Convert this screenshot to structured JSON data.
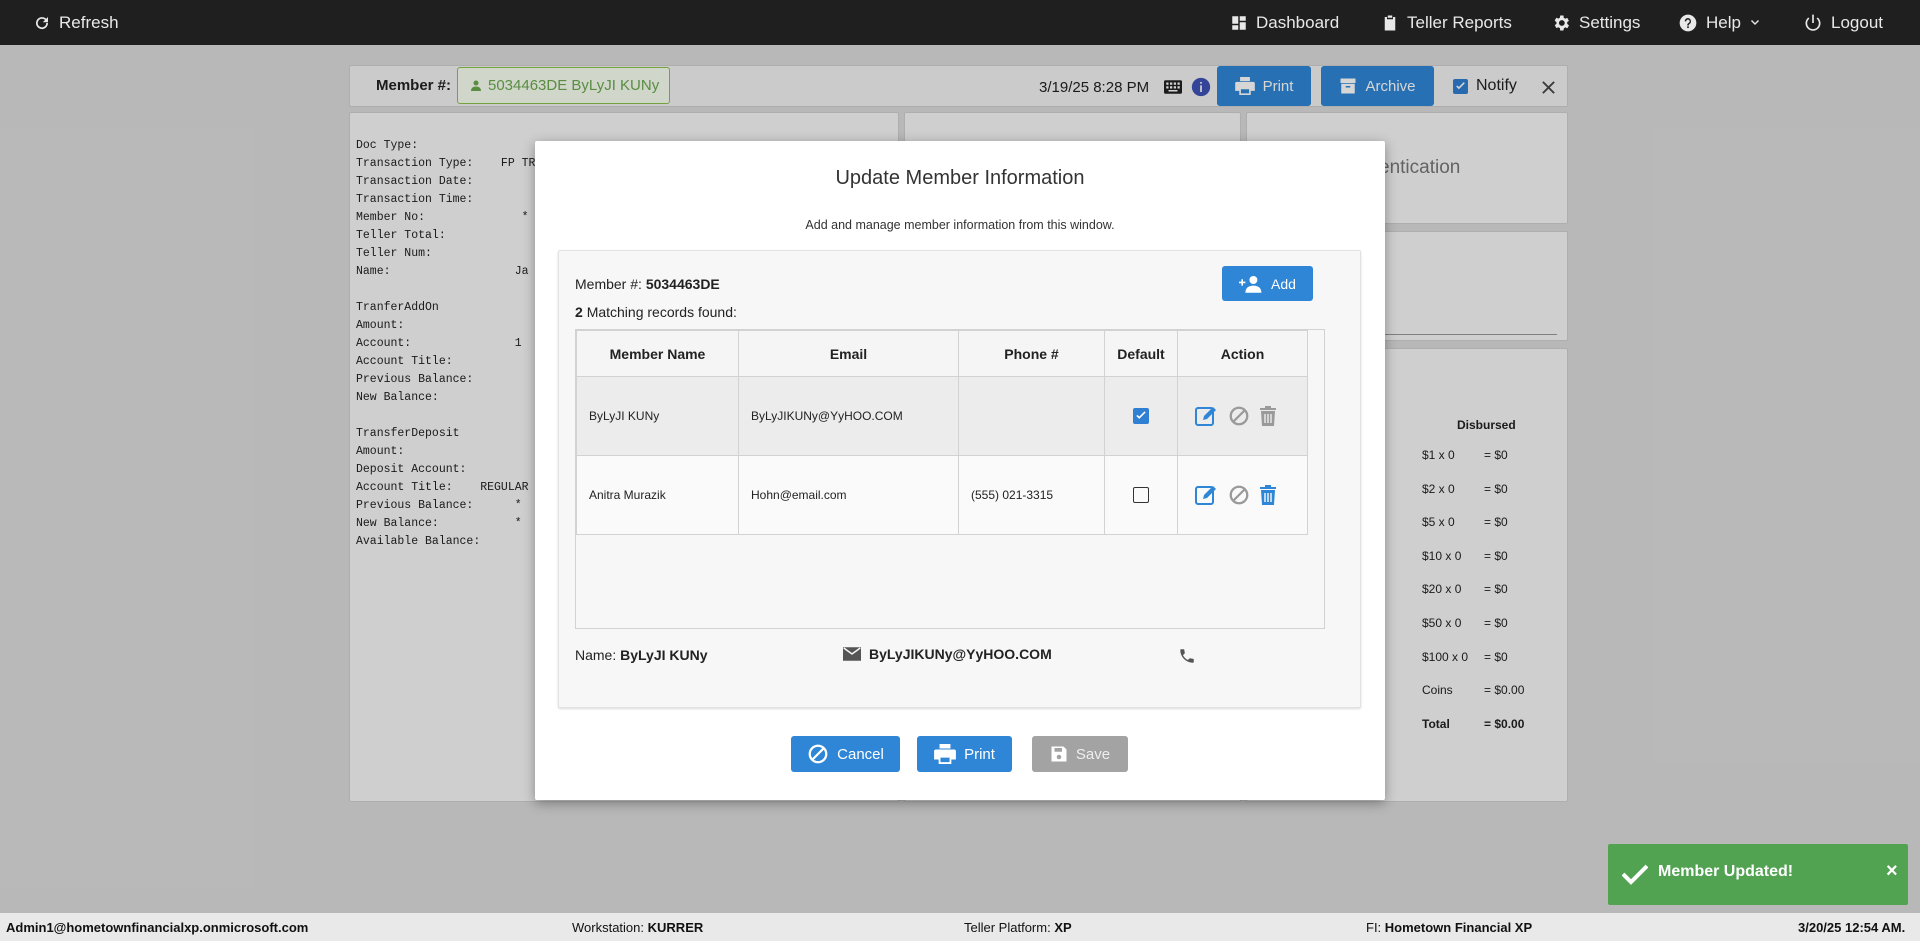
{
  "topbar": {
    "refresh": "Refresh",
    "dashboard": "Dashboard",
    "teller_reports": "Teller Reports",
    "settings": "Settings",
    "help": "Help",
    "logout": "Logout"
  },
  "header": {
    "member_label": "Member #:",
    "member_value": "5034463DE ByLyJI KUNy",
    "datetime": "3/19/25 8:28 PM",
    "print": "Print",
    "archive": "Archive",
    "notify": "Notify"
  },
  "receipt": {
    "lines": "Doc Type:\nTransaction Type:    FP TRA\nTransaction Date:\nTransaction Time:\nMember No:              *\nTeller Total:\nTeller Num:\nName:                  Ja\n\nTranferAddOn\nAmount:\nAccount:               1\nAccount Title:\nPrevious Balance:\nNew Balance:\n\nTransferDeposit\nAmount:\nDeposit Account:\nAccount Title:    REGULAR\nPrevious Balance:      *\nNew Balance:           *\nAvailable Balance:"
  },
  "right_panel": {
    "auth_title": "entication",
    "disbursed_header": "Disbursed",
    "rows": [
      {
        "label": "$1 x 0",
        "value": "= $0"
      },
      {
        "label": "$2 x 0",
        "value": "= $0"
      },
      {
        "label": "$5 x 0",
        "value": "= $0"
      },
      {
        "label": "$10 x 0",
        "value": "= $0"
      },
      {
        "label": "$20 x 0",
        "value": "= $0"
      },
      {
        "label": "$50 x 0",
        "value": "= $0"
      },
      {
        "label": "$100 x 0",
        "value": "= $0"
      },
      {
        "label": "Coins",
        "value": "= $0.00"
      },
      {
        "label": "Total",
        "value": "= $0.00"
      }
    ]
  },
  "modal": {
    "title": "Update Member Information",
    "subtitle": "Add and manage member information from this window.",
    "member_label": "Member #:",
    "member_value": "5034463DE",
    "add": "Add",
    "match_count": "2",
    "match_text": "Matching records found:",
    "columns": [
      "Member Name",
      "Email",
      "Phone #",
      "Default",
      "Action"
    ],
    "rows": [
      {
        "name": "ByLyJI KUNy",
        "email": "ByLyJIKUNy@YyHOO.COM",
        "phone": "",
        "default": true
      },
      {
        "name": "Anitra Murazik",
        "email": "Hohn@email.com",
        "phone": "(555) 021-3315",
        "default": false
      }
    ],
    "name_label": "Name:",
    "name_value": "ByLyJI KUNy",
    "email_value": "ByLyJIKUNy@YyHOO.COM",
    "cancel": "Cancel",
    "print": "Print",
    "save": "Save"
  },
  "toast": {
    "message": "Member Updated!",
    "close": "×"
  },
  "status": {
    "user": "Admin1@hometownfinancialxp.onmicrosoft.com",
    "workstation_label": "Workstation:",
    "workstation": "KURRER",
    "platform_label": "Teller Platform:",
    "platform": "XP",
    "fi_label": "FI:",
    "fi": "Hometown Financial XP",
    "datetime": "3/20/25 12:54 AM."
  },
  "colors": {
    "primary": "#2f86d6",
    "topbar": "#1f1f1f",
    "success": "#51a351",
    "member_green": "#6aa84f"
  }
}
